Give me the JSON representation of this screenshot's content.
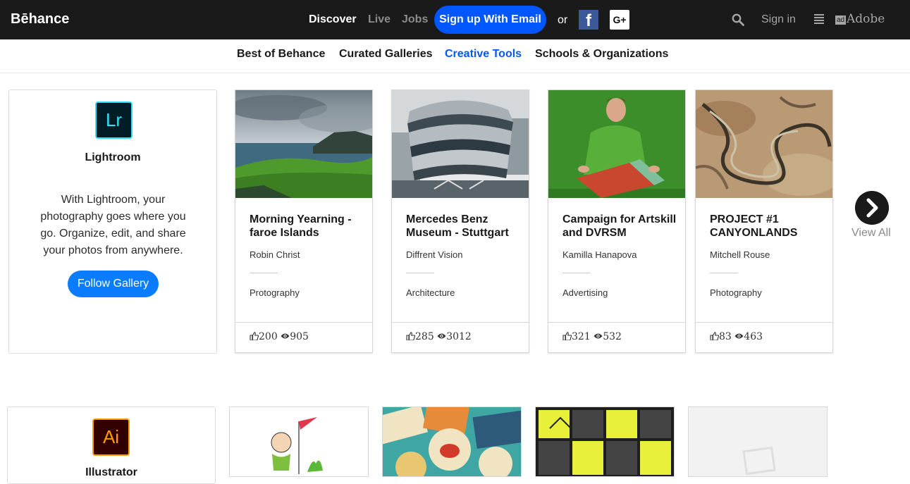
{
  "header": {
    "logo": "Bēhance",
    "nav": [
      "Discover",
      "Live",
      "Jobs"
    ],
    "signup_label": "Sign up With Email",
    "or_label": "or",
    "facebook_label": "f",
    "google_label": "G+",
    "signin_label": "Sign in",
    "adobe_label": "Adobe",
    "adobe_mark": "ad"
  },
  "subnav": [
    "Best of Behance",
    "Curated Galleries",
    "Creative Tools",
    "Schools & Organizations"
  ],
  "active_subnav": "Creative Tools",
  "galleries": [
    {
      "app_icon_text": "Lr",
      "app_icon_bg": "#001d26",
      "app_icon_border": "#31e0fa",
      "app_name": "Lightroom",
      "description": "With Lightroom, your photography goes where you go. Organize, edit, and share your photos from anywhere.",
      "follow_label": "Follow Gallery",
      "projects": [
        {
          "title": "Morning Yearning - faroe Islands",
          "owner": "Robin Christ",
          "field": "Protography",
          "appreciations": "200",
          "views": "905"
        },
        {
          "title": "Mercedes Benz Museum - Stuttgart",
          "owner": "Diffrent Vision",
          "field": "Architecture",
          "appreciations": "285",
          "views": "3012"
        },
        {
          "title": "Campaign for Artskill and DVRSM",
          "owner": "Kamilla Hanapova",
          "field": "Advertising",
          "appreciations": "321",
          "views": "532"
        },
        {
          "title": "PROJECT #1 CANYONLANDS",
          "owner": "Mitchell Rouse",
          "field": "Photography",
          "appreciations": "83",
          "views": "463"
        }
      ],
      "view_all_label": "View All"
    },
    {
      "app_icon_text": "Ai",
      "app_icon_bg": "#330000",
      "app_icon_border": "#ff9a00",
      "app_name": "Illustrator"
    }
  ],
  "colors": {
    "brand_blue": "#0057ff",
    "follow_blue": "#0a7cff",
    "topbar": "#1a1a1a"
  },
  "icons": [
    "search-icon",
    "menu-icon",
    "thumbs-up-icon",
    "eye-icon",
    "chevron-right-icon",
    "facebook-icon",
    "google-plus-icon"
  ]
}
